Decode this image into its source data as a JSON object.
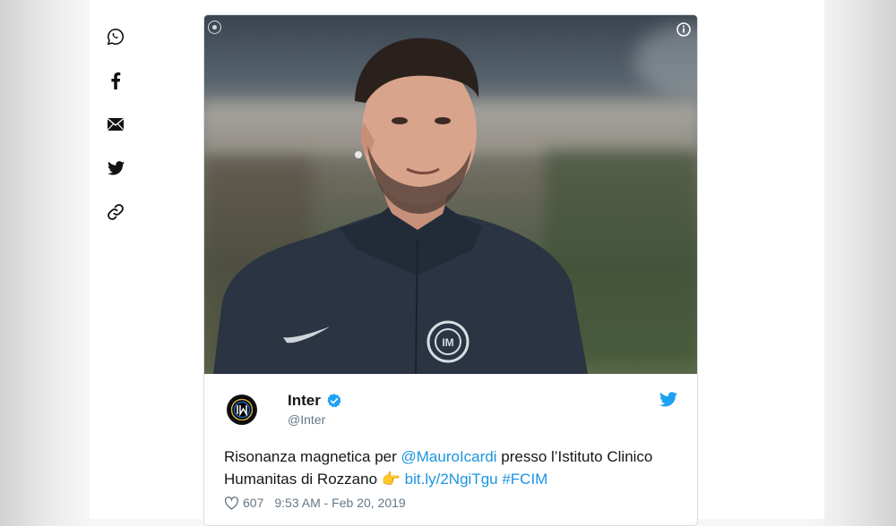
{
  "share": {
    "items": [
      {
        "name": "whatsapp"
      },
      {
        "name": "facebook"
      },
      {
        "name": "email"
      },
      {
        "name": "twitter"
      },
      {
        "name": "copy-link"
      }
    ]
  },
  "tweet": {
    "display_name": "Inter",
    "handle": "@Inter",
    "text_before_mention": "Risonanza magnetica per ",
    "mention": "@MauroIcardi",
    "text_after_mention": " presso l’Istituto Clinico Humanitas di Rozzano ",
    "emoji": "👉",
    "link": "bit.ly/2NgiTgu",
    "hashtag": "#FCIM",
    "like_count": "607",
    "timestamp": "9:53 AM - Feb 20, 2019"
  },
  "colors": {
    "link": "#1b95e0",
    "verified": "#1da1f2",
    "meta": "#657786",
    "text": "#14171a"
  }
}
